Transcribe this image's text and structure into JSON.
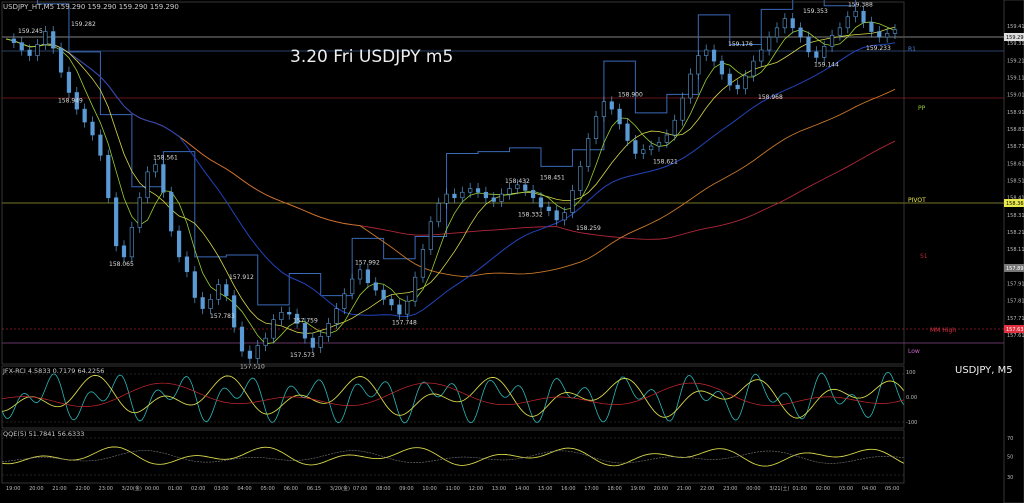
{
  "window": {
    "symbol_header": "USDJPY_HT,M5  159.290 159.290 159.290 159.290",
    "chart_title": "3.20 Fri USDJPY m5",
    "sub_label": "USDJPY, M5"
  },
  "indicators": {
    "rci_header": "JFX-RCI 4.5833 0.7179 64.2256",
    "qqe_header": "QQE(5) 51.7841 56.6333"
  },
  "levels": {
    "r1": "R1",
    "pp": "PP",
    "pivot": "PIVOT",
    "s1": "S1",
    "mm_high": "MM High",
    "low": "Low"
  },
  "colors": {
    "background": "#000000",
    "candle": "#5a9bd5",
    "ma_blue": "#2244bb",
    "ma_orange": "#c9782a",
    "ma_red": "#b0283a",
    "ma_green": "#9acd32",
    "ma_yellow": "#d6d64a",
    "step_line": "#3a6ab8",
    "pivot_yellow": "#e8e84c",
    "rci_cyan": "#2bb6b6",
    "rci_yellow": "#d6d64a"
  },
  "chart_data": {
    "type": "line",
    "price_labels": [
      {
        "x": "19:10",
        "y": 159.245,
        "text": "159.245"
      },
      {
        "x": "21:10",
        "y": 159.282,
        "text": "159.282"
      },
      {
        "x": "20:40",
        "y": 158.949,
        "text": "158.949"
      },
      {
        "x": "00:40",
        "y": 158.561,
        "text": "158.561"
      },
      {
        "x": "23:10",
        "y": 158.065,
        "text": "158.065"
      },
      {
        "x": "03:50",
        "y": 157.912,
        "text": "157.912"
      },
      {
        "x": "03:00",
        "y": 157.783,
        "text": "157.783"
      },
      {
        "x": "05:40",
        "y": 157.759,
        "text": "157.759"
      },
      {
        "x": "04:20",
        "y": 157.51,
        "text": "157.510"
      },
      {
        "x": "06:20",
        "y": 157.573,
        "text": "157.573"
      },
      {
        "x": "08:40",
        "y": 157.992,
        "text": "157.992"
      },
      {
        "x": "09:40",
        "y": 157.748,
        "text": "157.748"
      },
      {
        "x": "14:20",
        "y": 158.432,
        "text": "158.432"
      },
      {
        "x": "15:20",
        "y": 158.451,
        "text": "158.451"
      },
      {
        "x": "14:50",
        "y": 158.332,
        "text": "158.332"
      },
      {
        "x": "17:00",
        "y": 158.259,
        "text": "158.259"
      },
      {
        "x": "19:00",
        "y": 158.9,
        "text": "158.900"
      },
      {
        "x": "20:10",
        "y": 158.621,
        "text": "158.621"
      },
      {
        "x": "23:50",
        "y": 159.176,
        "text": "159.176"
      },
      {
        "x": "01:20",
        "y": 158.968,
        "text": "158.968"
      },
      {
        "x": "03:00",
        "y": 159.144,
        "text": "159.144"
      },
      {
        "x": "03:00",
        "y": 159.353,
        "text": "159.353"
      },
      {
        "x": "04:40",
        "y": 159.388,
        "text": "159.388"
      },
      {
        "x": "05:20",
        "y": 159.233,
        "text": "159.233"
      }
    ],
    "y_ticks": [
      "159.41",
      "159.31",
      "159.21",
      "159.11",
      "159.01",
      "158.91",
      "158.81",
      "158.71",
      "158.61",
      "158.51",
      "158.41",
      "158.31",
      "158.21",
      "158.11",
      "158.01",
      "157.91",
      "157.81",
      "157.71",
      "157.61"
    ],
    "x_ticks": [
      "19:00",
      "20:00",
      "21:00",
      "22:00",
      "23:00",
      "3/20(金)",
      "00:00",
      "01:00",
      "02:00",
      "03:00",
      "04:00",
      "05:00",
      "06:00",
      "06:15",
      "3/20(金)",
      "07:00",
      "08:00",
      "09:00",
      "10:00",
      "11:00",
      "12:00",
      "13:00",
      "14:00",
      "15:00",
      "16:00",
      "17:00",
      "18:00",
      "19:00",
      "20:00",
      "21:00",
      "22:00",
      "23:00",
      "00:00",
      "3/21(土)",
      "01:00",
      "02:00",
      "03:00",
      "04:00",
      "05:00"
    ],
    "right_axis_markers": [
      "159.29",
      "158.36",
      "157.89",
      "157.63"
    ],
    "rci_ticks": [
      "100",
      "0.00",
      "-100"
    ],
    "qqe_ticks": [
      "70",
      "50",
      "30"
    ],
    "series": [
      {
        "values": [
          159.24,
          159.22,
          159.18,
          159.15,
          159.21,
          159.28,
          159.19,
          159.06,
          158.95,
          158.86,
          158.79,
          158.72,
          158.61,
          158.38,
          158.12,
          158.06,
          158.22,
          158.38,
          158.52,
          158.56,
          158.41,
          158.2,
          158.06,
          157.98,
          157.84,
          157.78,
          157.83,
          157.91,
          157.85,
          157.68,
          157.55,
          157.51,
          157.58,
          157.62,
          157.72,
          157.76,
          157.75,
          157.7,
          157.62,
          157.57,
          157.63,
          157.7,
          157.78,
          157.86,
          157.94,
          157.99,
          157.92,
          157.88,
          157.83,
          157.8,
          157.75,
          157.82,
          157.95,
          158.1,
          158.25,
          158.35,
          158.4,
          158.38,
          158.41,
          158.43,
          158.41,
          158.38,
          158.36,
          158.4,
          158.43,
          158.45,
          158.42,
          158.38,
          158.33,
          158.31,
          158.26,
          158.3,
          158.42,
          158.55,
          158.7,
          158.82,
          158.9,
          158.86,
          158.78,
          158.69,
          158.62,
          158.64,
          158.66,
          158.68,
          158.72,
          158.8,
          158.92,
          159.05,
          159.15,
          159.18,
          159.12,
          159.05,
          158.99,
          158.97,
          159.04,
          159.12,
          159.18,
          159.25,
          159.3,
          159.35,
          159.3,
          159.25,
          159.17,
          159.14,
          159.2,
          159.26,
          159.3,
          159.36,
          159.39,
          159.33,
          159.28,
          159.25,
          159.27,
          159.29
        ]
      }
    ]
  }
}
